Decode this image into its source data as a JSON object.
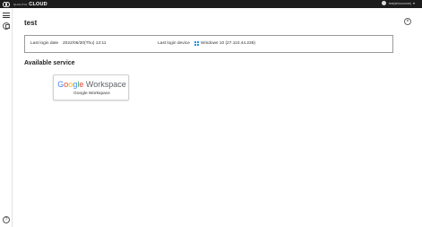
{
  "app": {
    "brand_small": "QUALITIA",
    "brand_big": "CLOUD",
    "user_name": "test(shinonome)"
  },
  "page": {
    "title": "test",
    "close_glyph": "×"
  },
  "last_login": {
    "date_label": "Last login date",
    "date_value": "2022/06/30(Thu) 12:11",
    "device_label": "Last login device",
    "device_value": "Windows 10 (27.110.44.236)"
  },
  "services": {
    "section_title": "Available service",
    "items": [
      {
        "logo_letters": [
          "G",
          "o",
          "o",
          "g",
          "l",
          "e"
        ],
        "logo_suffix": "Workspace",
        "name": "Google Workspace"
      }
    ]
  },
  "icons": {
    "menu": "hamburger-menu-icon",
    "home": "home-icon",
    "help": "help-icon",
    "close": "close-icon",
    "user": "user-icon",
    "windows": "windows-logo-icon"
  },
  "colors": {
    "topbar": "#1c1c1c",
    "google_blue": "#4285f4",
    "google_red": "#ea4335",
    "google_yellow": "#fbbc05",
    "google_green": "#34a853",
    "windows_blue": "#1e90e0"
  }
}
